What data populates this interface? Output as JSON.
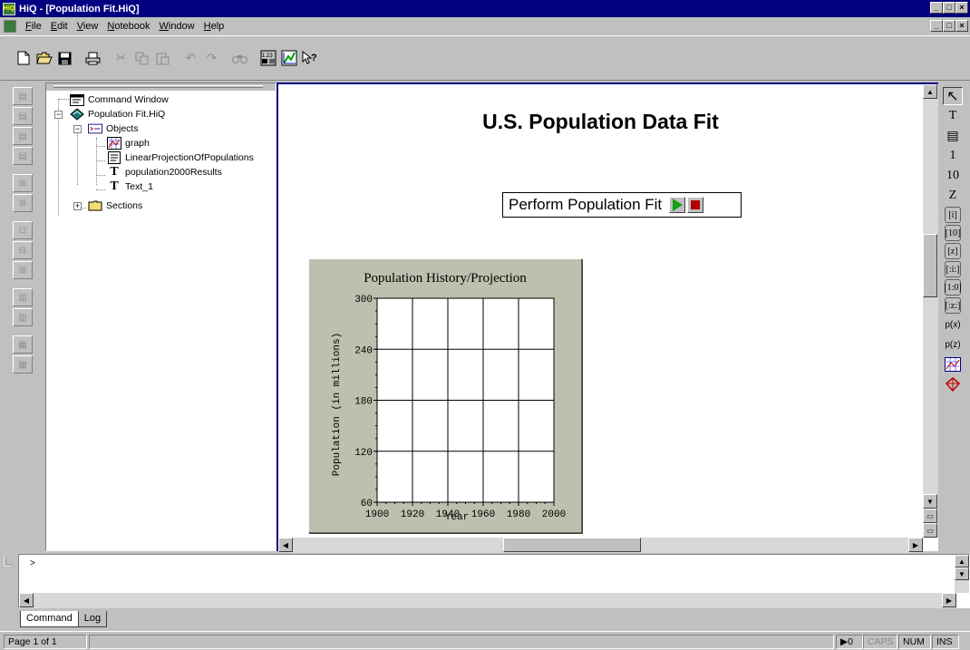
{
  "window": {
    "title": "HiQ - [Population Fit.HiQ]",
    "app_icon_text": "HiQ",
    "minimize": "_",
    "maximize": "□",
    "close": "×",
    "restore": "ơ"
  },
  "menu": {
    "items": [
      {
        "label": "File",
        "key": "F",
        "rest": "ile"
      },
      {
        "label": "Edit",
        "key": "E",
        "rest": "dit"
      },
      {
        "label": "View",
        "key": "V",
        "rest": "iew"
      },
      {
        "label": "Notebook",
        "key": "N",
        "rest": "otebook"
      },
      {
        "label": "Window",
        "key": "W",
        "rest": "indow"
      },
      {
        "label": "Help",
        "key": "H",
        "rest": "elp"
      }
    ]
  },
  "tree": {
    "command_window": "Command Window",
    "notebook": "Population Fit.HiQ",
    "objects": "Objects",
    "graph": "graph",
    "linear_projection": "LinearProjectionOfPopulations",
    "population_results": "population2000Results",
    "text_1": "Text_1",
    "sections": "Sections"
  },
  "document": {
    "title": "U.S. Population Data Fit",
    "fit_button_label": "Perform Population Fit"
  },
  "chart_data": {
    "type": "line",
    "title": "Population History/Projection",
    "xlabel": "Year",
    "ylabel": "Population (in millions)",
    "xlim": [
      1900,
      2000
    ],
    "ylim": [
      60,
      300
    ],
    "x_ticks": [
      "1900",
      "1920",
      "1940",
      "1960",
      "1980",
      "2000"
    ],
    "y_ticks": [
      "300",
      "240",
      "180",
      "120",
      "60"
    ],
    "grid": true,
    "series": [],
    "colors": {
      "plot_bg": "#ffffff",
      "frame_bg": "#bfbfaf",
      "grid": "#000000"
    }
  },
  "command": {
    "prompt": ">",
    "tabs": [
      "Command",
      "Log"
    ]
  },
  "status": {
    "page": "Page 1 of 1",
    "running": "▶0",
    "caps": "CAPS",
    "num": "NUM",
    "ins": "INS"
  },
  "right_tools": [
    "↖",
    "T",
    "▤",
    "1",
    "10",
    "Z",
    "[i]",
    "[10]",
    "[z]",
    "[:i:]",
    "[1:0]",
    "[:z:]",
    "p(x)",
    "p(z)"
  ],
  "colors": {
    "titlebar": "#000080",
    "chrome": "#c0c0c0",
    "play_green": "#16a016",
    "stop_red": "#b00000"
  }
}
